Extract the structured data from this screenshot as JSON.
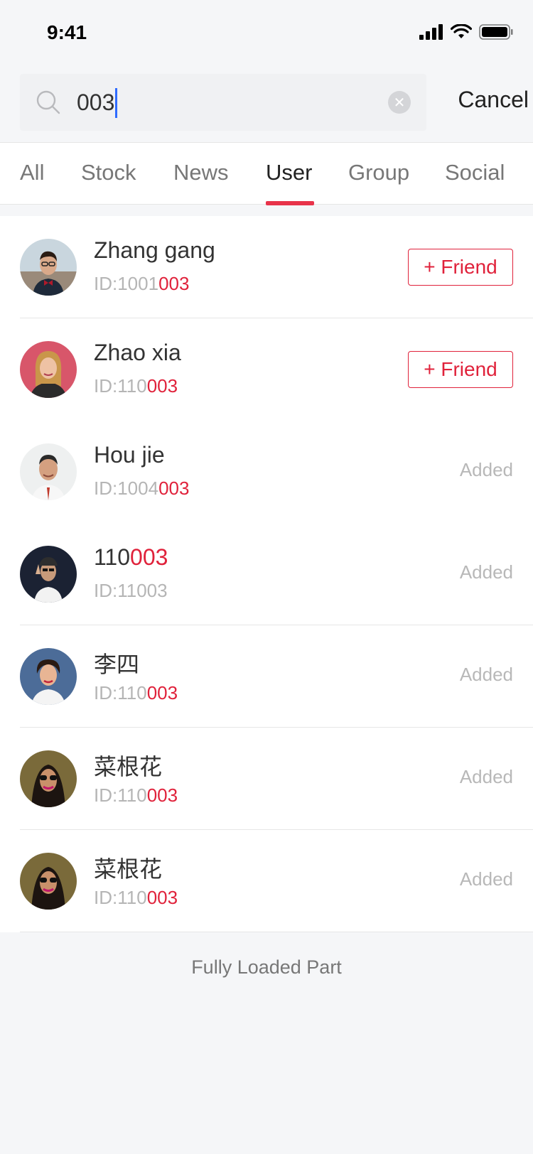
{
  "status": {
    "time": "9:41"
  },
  "search": {
    "value": "003",
    "cancel_label": "Cancel"
  },
  "tabs": [
    {
      "label": "All",
      "active": false
    },
    {
      "label": "Stock",
      "active": false
    },
    {
      "label": "News",
      "active": false
    },
    {
      "label": "User",
      "active": true
    },
    {
      "label": "Group",
      "active": false
    },
    {
      "label": "Social",
      "active": false
    }
  ],
  "users": [
    {
      "name_prefix": "Zhang gang",
      "name_highlight": "",
      "id_prefix": "ID:1001",
      "id_highlight": "003",
      "action": "+ Friend",
      "action_type": "friend",
      "avatar_icon": "avatar-man-bowtie"
    },
    {
      "name_prefix": "Zhao xia",
      "name_highlight": "",
      "id_prefix": "ID:110",
      "id_highlight": "003",
      "action": "+ Friend",
      "action_type": "friend",
      "avatar_icon": "avatar-woman-blonde"
    },
    {
      "name_prefix": "Hou jie",
      "name_highlight": "",
      "id_prefix": "ID:1004",
      "id_highlight": "003",
      "action": "Added",
      "action_type": "added",
      "avatar_icon": "avatar-man-smiling"
    },
    {
      "name_prefix": "110",
      "name_highlight": "003",
      "id_prefix": "ID:11003",
      "id_highlight": "",
      "action": "Added",
      "action_type": "added",
      "avatar_icon": "avatar-man-dark"
    },
    {
      "name_prefix": "李四",
      "name_highlight": "",
      "id_prefix": "ID:110",
      "id_highlight": "003",
      "action": "Added",
      "action_type": "added",
      "avatar_icon": "avatar-woman-retro"
    },
    {
      "name_prefix": "菜根花",
      "name_highlight": "",
      "id_prefix": "ID:110",
      "id_highlight": "003",
      "action": "Added",
      "action_type": "added",
      "avatar_icon": "avatar-woman-sunglasses"
    },
    {
      "name_prefix": "菜根花",
      "name_highlight": "",
      "id_prefix": "ID:110",
      "id_highlight": "003",
      "action": "Added",
      "action_type": "added",
      "avatar_icon": "avatar-woman-sunglasses"
    }
  ],
  "footer": {
    "text": "Fully Loaded Part"
  },
  "colors": {
    "accent": "#e0223b",
    "tab_indicator": "#e8334a",
    "caret": "#2f6bff"
  }
}
